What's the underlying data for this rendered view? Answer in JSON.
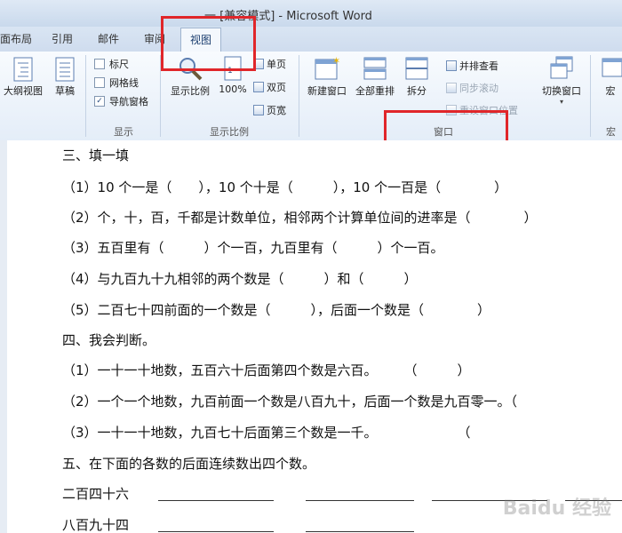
{
  "window": {
    "title": "一 [兼容模式] - Microsoft Word"
  },
  "tabs": [
    "面布局",
    "引用",
    "邮件",
    "审阅",
    "视图"
  ],
  "active_tab": "视图",
  "ribbon": {
    "views": {
      "outline": "大纲视图",
      "draft": "草稿"
    },
    "show": {
      "ruler": "标尺",
      "gridlines": "网格线",
      "navpane": "导航窗格",
      "group": "显示"
    },
    "zoom": {
      "zoom": "显示比例",
      "percent": "100%",
      "one_page": "单页",
      "two_pages": "双页",
      "page_width": "页宽",
      "group": "显示比例"
    },
    "window": {
      "new_window": "新建窗口",
      "arrange_all": "全部重排",
      "split": "拆分",
      "side_by_side": "并排查看",
      "sync_scroll": "同步滚动",
      "reset_pos": "重设窗口位置",
      "switch": "切换窗口",
      "group": "窗口"
    },
    "macros": {
      "macro": "宏",
      "group": "宏"
    }
  },
  "document": {
    "lines": [
      "三、填一填",
      "（1）10 个一是（　　），10 个十是（　　　），10 个一百是（　　　　）",
      "（2）个，十，百，千都是计数单位，相邻两个计算单位间的进率是（　　　　）",
      "（3）五百里有（　　　）个一百，九百里有（　　　）个一百。",
      "（4）与九百九十九相邻的两个数是（　　　）和（　　　）",
      "（5）二百七十四前面的一个数是（　　　），后面一个数是（　　　　）",
      "四、我会判断。",
      "（1）一十一十地数，五百六十后面第四个数是六百。　　　（　　　）",
      "（2）一个一个地数，九百前面一个数是八百九十，后面一个数是九百零一。（",
      "（3）一十一十地数，九百七十后面第三个数是一千。　　　　　　　（",
      "五、在下面的各数的后面连续数出四个数。",
      "二百四十六",
      "八百九十四"
    ]
  },
  "watermark": "Baidu 经验"
}
